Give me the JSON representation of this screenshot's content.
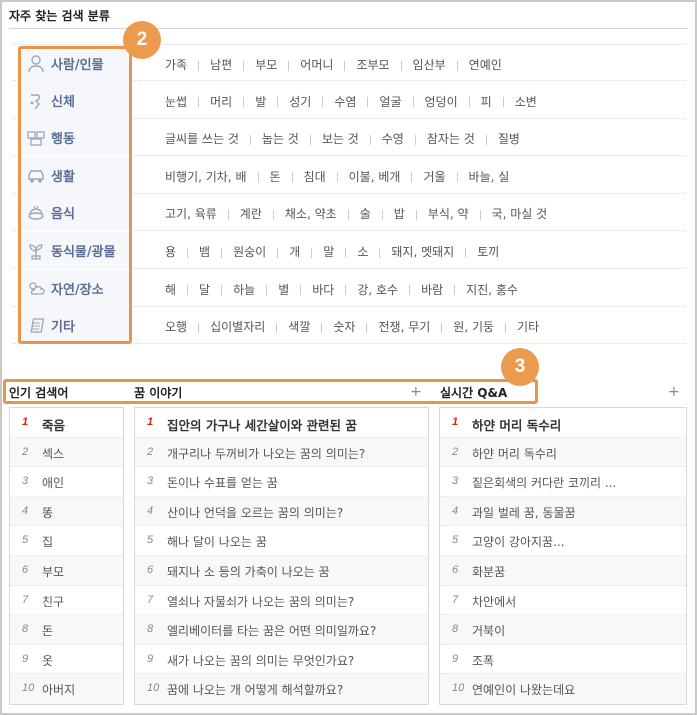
{
  "header": {
    "title": "자주 찾는 검색 분류"
  },
  "badges": {
    "two": "2",
    "three": "3"
  },
  "categories": [
    {
      "icon": "person-icon",
      "name": "사람/인물",
      "items": [
        "가족",
        "남편",
        "부모",
        "어머니",
        "조부모",
        "임산부",
        "연예인"
      ]
    },
    {
      "icon": "body-icon",
      "name": "신체",
      "items": [
        "눈썹",
        "머리",
        "발",
        "성기",
        "수염",
        "얼굴",
        "엉덩이",
        "피",
        "소변"
      ]
    },
    {
      "icon": "action-icon",
      "name": "행동",
      "items": [
        "글씨를 쓰는 것",
        "눕는 것",
        "보는 것",
        "수영",
        "잠자는 것",
        "질병"
      ]
    },
    {
      "icon": "car-icon",
      "name": "생활",
      "items": [
        "비행기, 기차, 배",
        "돈",
        "침대",
        "이불, 베개",
        "거울",
        "바늘, 실"
      ]
    },
    {
      "icon": "food-icon",
      "name": "음식",
      "items": [
        "고기, 육류",
        "계란",
        "채소, 약초",
        "술",
        "밥",
        "부식, 약",
        "국, 마실 것"
      ]
    },
    {
      "icon": "plant-icon",
      "name": "동식물/광물",
      "items": [
        "용",
        "뱀",
        "원숭이",
        "개",
        "말",
        "소",
        "돼지, 멧돼지",
        "토끼"
      ]
    },
    {
      "icon": "nature-icon",
      "name": "자연/장소",
      "items": [
        "해",
        "달",
        "하늘",
        "별",
        "바다",
        "강, 호수",
        "바람",
        "지진, 홍수"
      ]
    },
    {
      "icon": "scroll-icon",
      "name": "기타",
      "items": [
        "오행",
        "십이별자리",
        "색깔",
        "숫자",
        "전쟁, 무기",
        "원, 기둥",
        "기타"
      ]
    }
  ],
  "popular": {
    "title": "인기 검색어",
    "items": [
      "죽음",
      "섹스",
      "애인",
      "똥",
      "집",
      "부모",
      "친구",
      "돈",
      "옷",
      "아버지"
    ]
  },
  "stories": {
    "title": "꿈 이야기",
    "more": "+",
    "items": [
      "집안의 가구나 세간살이와 관련된 꿈",
      "개구리나 두꺼비가 나오는 꿈의 의미는?",
      "돈이나 수표를 얻는 꿈",
      "산이나 언덕을 오르는 꿈의 의미는?",
      "해나 달이 나오는 꿈",
      "돼지나 소 등의 가축이 나오는 꿈",
      "열쇠나 자물쇠가 나오는 꿈의 의미는?",
      "엘리베이터를 타는 꿈은 어떤 의미일까요?",
      "새가 나오는 꿈의 의미는 무엇인가요?",
      "꿈에 나오는 개 어떻게 해석할까요?"
    ]
  },
  "qna": {
    "title": "실시간 Q&A",
    "more": "+",
    "items": [
      "하얀 머리 독수리",
      "하얀 머리 독수리",
      "짙은회색의 커다란 코끼리 ...",
      "과일 벌레 꿈, 동물꿈",
      "고양이 강아지꿈...",
      "화분꿈",
      "차안에서",
      "거북이",
      "조폭",
      "연예인이 나왔는데요"
    ]
  },
  "colors": {
    "accent": "#e8954a",
    "category_label": "#5a6f96",
    "rank_first": "#dd2211"
  }
}
